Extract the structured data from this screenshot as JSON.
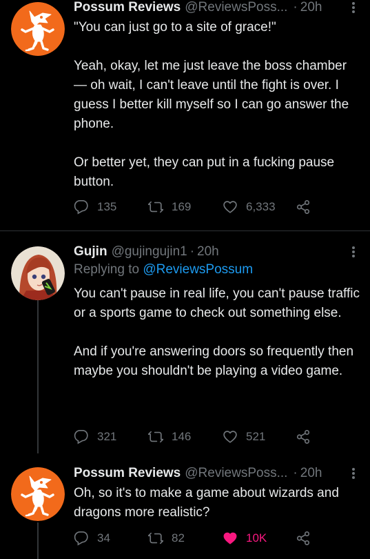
{
  "tweets": [
    {
      "name": "Possum Reviews",
      "handle": "@ReviewsPoss...",
      "time": "20h",
      "body": "\"You can just go to a site of grace!\"\n\nYeah, okay, let me just leave the boss chamber— oh wait, I can't leave until the fight is over. I guess I better kill myself so I can go answer the phone.\n\nOr better yet, they can put in a fucking pause button.",
      "replies": "135",
      "retweets": "169",
      "likes": "6,333"
    },
    {
      "name": "Gujin",
      "handle": "@gujingujin1",
      "time": "20h",
      "replying_label": "Replying to",
      "replying_handle": "@ReviewsPossum",
      "body": "You can't pause in real life, you can't pause traffic or a sports game to check out something else.\n\nAnd if you're answering doors so frequently then maybe you shouldn't be playing a video game.",
      "replies": "321",
      "retweets": "146",
      "likes": "521"
    },
    {
      "name": "Possum Reviews",
      "handle": "@ReviewsPoss...",
      "time": "20h",
      "body": "Oh, so it's to make a game about wizards and dragons more realistic?",
      "replies": "34",
      "retweets": "82",
      "likes": "10K"
    }
  ],
  "icons": {
    "reply": "reply-icon",
    "retweet": "retweet-icon",
    "like": "heart-icon",
    "share": "share-icon",
    "more": "more-icon"
  },
  "colors": {
    "background": "#000000",
    "text": "#e7e9ea",
    "muted": "#71767b",
    "link": "#1d9bf0",
    "liked": "#f91880",
    "avatar_orange": "#f26a1b"
  }
}
